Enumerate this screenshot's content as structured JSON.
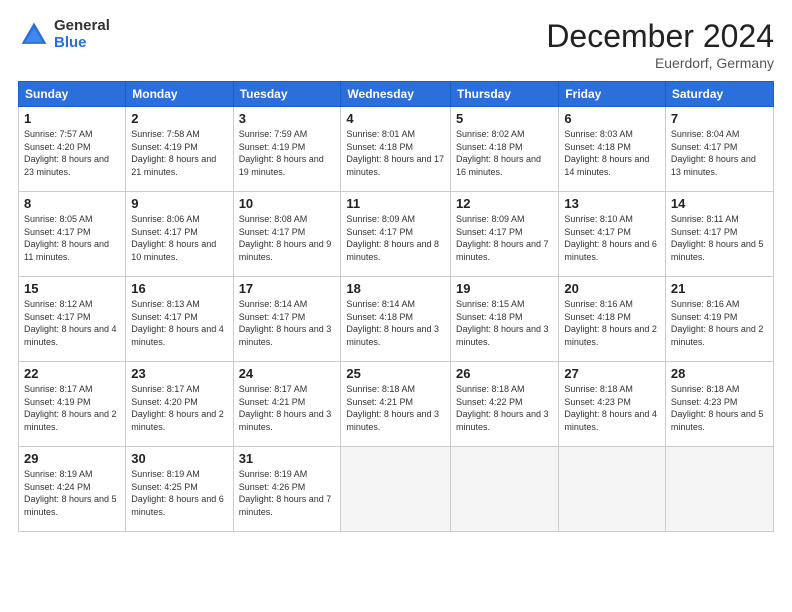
{
  "logo": {
    "general": "General",
    "blue": "Blue"
  },
  "header": {
    "month": "December 2024",
    "location": "Euerdorf, Germany"
  },
  "days_of_week": [
    "Sunday",
    "Monday",
    "Tuesday",
    "Wednesday",
    "Thursday",
    "Friday",
    "Saturday"
  ],
  "weeks": [
    [
      {
        "day": "1",
        "sunrise": "7:57 AM",
        "sunset": "4:20 PM",
        "daylight": "8 hours and 23 minutes."
      },
      {
        "day": "2",
        "sunrise": "7:58 AM",
        "sunset": "4:19 PM",
        "daylight": "8 hours and 21 minutes."
      },
      {
        "day": "3",
        "sunrise": "7:59 AM",
        "sunset": "4:19 PM",
        "daylight": "8 hours and 19 minutes."
      },
      {
        "day": "4",
        "sunrise": "8:01 AM",
        "sunset": "4:18 PM",
        "daylight": "8 hours and 17 minutes."
      },
      {
        "day": "5",
        "sunrise": "8:02 AM",
        "sunset": "4:18 PM",
        "daylight": "8 hours and 16 minutes."
      },
      {
        "day": "6",
        "sunrise": "8:03 AM",
        "sunset": "4:18 PM",
        "daylight": "8 hours and 14 minutes."
      },
      {
        "day": "7",
        "sunrise": "8:04 AM",
        "sunset": "4:17 PM",
        "daylight": "8 hours and 13 minutes."
      }
    ],
    [
      {
        "day": "8",
        "sunrise": "8:05 AM",
        "sunset": "4:17 PM",
        "daylight": "8 hours and 11 minutes."
      },
      {
        "day": "9",
        "sunrise": "8:06 AM",
        "sunset": "4:17 PM",
        "daylight": "8 hours and 10 minutes."
      },
      {
        "day": "10",
        "sunrise": "8:08 AM",
        "sunset": "4:17 PM",
        "daylight": "8 hours and 9 minutes."
      },
      {
        "day": "11",
        "sunrise": "8:09 AM",
        "sunset": "4:17 PM",
        "daylight": "8 hours and 8 minutes."
      },
      {
        "day": "12",
        "sunrise": "8:09 AM",
        "sunset": "4:17 PM",
        "daylight": "8 hours and 7 minutes."
      },
      {
        "day": "13",
        "sunrise": "8:10 AM",
        "sunset": "4:17 PM",
        "daylight": "8 hours and 6 minutes."
      },
      {
        "day": "14",
        "sunrise": "8:11 AM",
        "sunset": "4:17 PM",
        "daylight": "8 hours and 5 minutes."
      }
    ],
    [
      {
        "day": "15",
        "sunrise": "8:12 AM",
        "sunset": "4:17 PM",
        "daylight": "8 hours and 4 minutes."
      },
      {
        "day": "16",
        "sunrise": "8:13 AM",
        "sunset": "4:17 PM",
        "daylight": "8 hours and 4 minutes."
      },
      {
        "day": "17",
        "sunrise": "8:14 AM",
        "sunset": "4:17 PM",
        "daylight": "8 hours and 3 minutes."
      },
      {
        "day": "18",
        "sunrise": "8:14 AM",
        "sunset": "4:18 PM",
        "daylight": "8 hours and 3 minutes."
      },
      {
        "day": "19",
        "sunrise": "8:15 AM",
        "sunset": "4:18 PM",
        "daylight": "8 hours and 3 minutes."
      },
      {
        "day": "20",
        "sunrise": "8:16 AM",
        "sunset": "4:18 PM",
        "daylight": "8 hours and 2 minutes."
      },
      {
        "day": "21",
        "sunrise": "8:16 AM",
        "sunset": "4:19 PM",
        "daylight": "8 hours and 2 minutes."
      }
    ],
    [
      {
        "day": "22",
        "sunrise": "8:17 AM",
        "sunset": "4:19 PM",
        "daylight": "8 hours and 2 minutes."
      },
      {
        "day": "23",
        "sunrise": "8:17 AM",
        "sunset": "4:20 PM",
        "daylight": "8 hours and 2 minutes."
      },
      {
        "day": "24",
        "sunrise": "8:17 AM",
        "sunset": "4:21 PM",
        "daylight": "8 hours and 3 minutes."
      },
      {
        "day": "25",
        "sunrise": "8:18 AM",
        "sunset": "4:21 PM",
        "daylight": "8 hours and 3 minutes."
      },
      {
        "day": "26",
        "sunrise": "8:18 AM",
        "sunset": "4:22 PM",
        "daylight": "8 hours and 3 minutes."
      },
      {
        "day": "27",
        "sunrise": "8:18 AM",
        "sunset": "4:23 PM",
        "daylight": "8 hours and 4 minutes."
      },
      {
        "day": "28",
        "sunrise": "8:18 AM",
        "sunset": "4:23 PM",
        "daylight": "8 hours and 5 minutes."
      }
    ],
    [
      {
        "day": "29",
        "sunrise": "8:19 AM",
        "sunset": "4:24 PM",
        "daylight": "8 hours and 5 minutes."
      },
      {
        "day": "30",
        "sunrise": "8:19 AM",
        "sunset": "4:25 PM",
        "daylight": "8 hours and 6 minutes."
      },
      {
        "day": "31",
        "sunrise": "8:19 AM",
        "sunset": "4:26 PM",
        "daylight": "8 hours and 7 minutes."
      },
      null,
      null,
      null,
      null
    ]
  ]
}
